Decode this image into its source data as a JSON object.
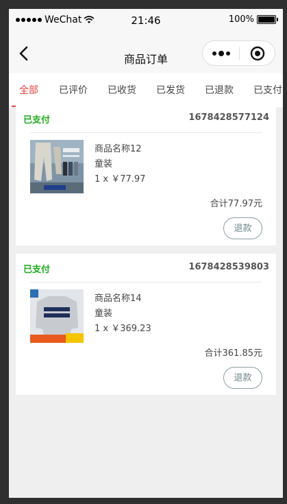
{
  "status_bar": {
    "carrier": "WeChat",
    "time": "21:46",
    "battery": "100%"
  },
  "nav": {
    "title": "商品订单",
    "back_icon": "chevron-left-icon",
    "more_icon": "more-dots-icon",
    "close_icon": "target-close-icon"
  },
  "tabs": [
    {
      "label": "全部",
      "active": true
    },
    {
      "label": "已评价",
      "active": false
    },
    {
      "label": "已收货",
      "active": false
    },
    {
      "label": "已发货",
      "active": false
    },
    {
      "label": "已退款",
      "active": false
    },
    {
      "label": "已支付",
      "active": false
    }
  ],
  "colors": {
    "accent": "#e64340",
    "paid_status": "#1aad19",
    "refund_border": "#8a9fa3"
  },
  "orders": [
    {
      "status": "已支付",
      "order_no": "1678428577124",
      "product_name": "商品名称12",
      "product_attr": "童装",
      "qty_price": "1 x ￥77.97",
      "total": "合计77.97元",
      "refund_label": "退款"
    },
    {
      "status": "已支付",
      "order_no": "1678428539803",
      "product_name": "商品名称14",
      "product_attr": "童装",
      "qty_price": "1 x ￥369.23",
      "total": "合计361.85元",
      "refund_label": "退款"
    }
  ]
}
